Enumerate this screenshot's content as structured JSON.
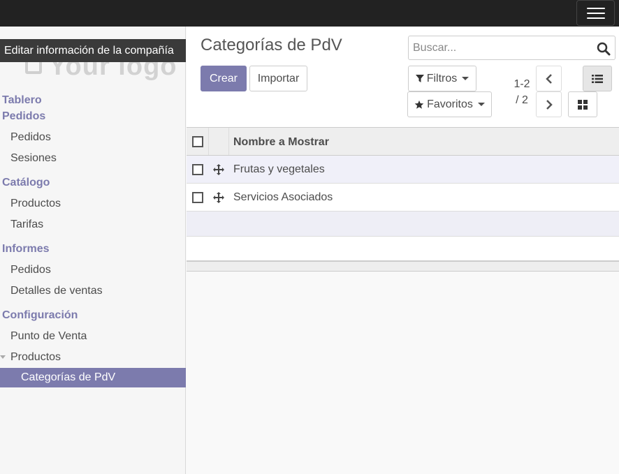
{
  "sidebar": {
    "tooltip": "Editar información de la compañía",
    "logo_text": "Your logo",
    "sections": [
      {
        "header": "Tablero",
        "items": []
      },
      {
        "header": "Pedidos",
        "items": [
          "Pedidos",
          "Sesiones"
        ]
      },
      {
        "header": "Catálogo",
        "items": [
          "Productos",
          "Tarifas"
        ]
      },
      {
        "header": "Informes",
        "items": [
          "Pedidos",
          "Detalles de ventas"
        ]
      },
      {
        "header": "Configuración",
        "items": [
          "Punto de Venta",
          "Productos"
        ]
      }
    ],
    "active_subitem": "Categorías de PdV"
  },
  "control_panel": {
    "title": "Categorías de PdV",
    "create_label": "Crear",
    "import_label": "Importar",
    "search_placeholder": "Buscar...",
    "filters_label": "Filtros",
    "favorites_label": "Favoritos",
    "pager_range": "1-2",
    "pager_total": "/ 2"
  },
  "list": {
    "column_header": "Nombre a Mostrar",
    "rows": [
      "Frutas y vegetales",
      "Servicios Asociados"
    ]
  },
  "colors": {
    "accent": "#7c7bad",
    "topbar": "#222222"
  }
}
